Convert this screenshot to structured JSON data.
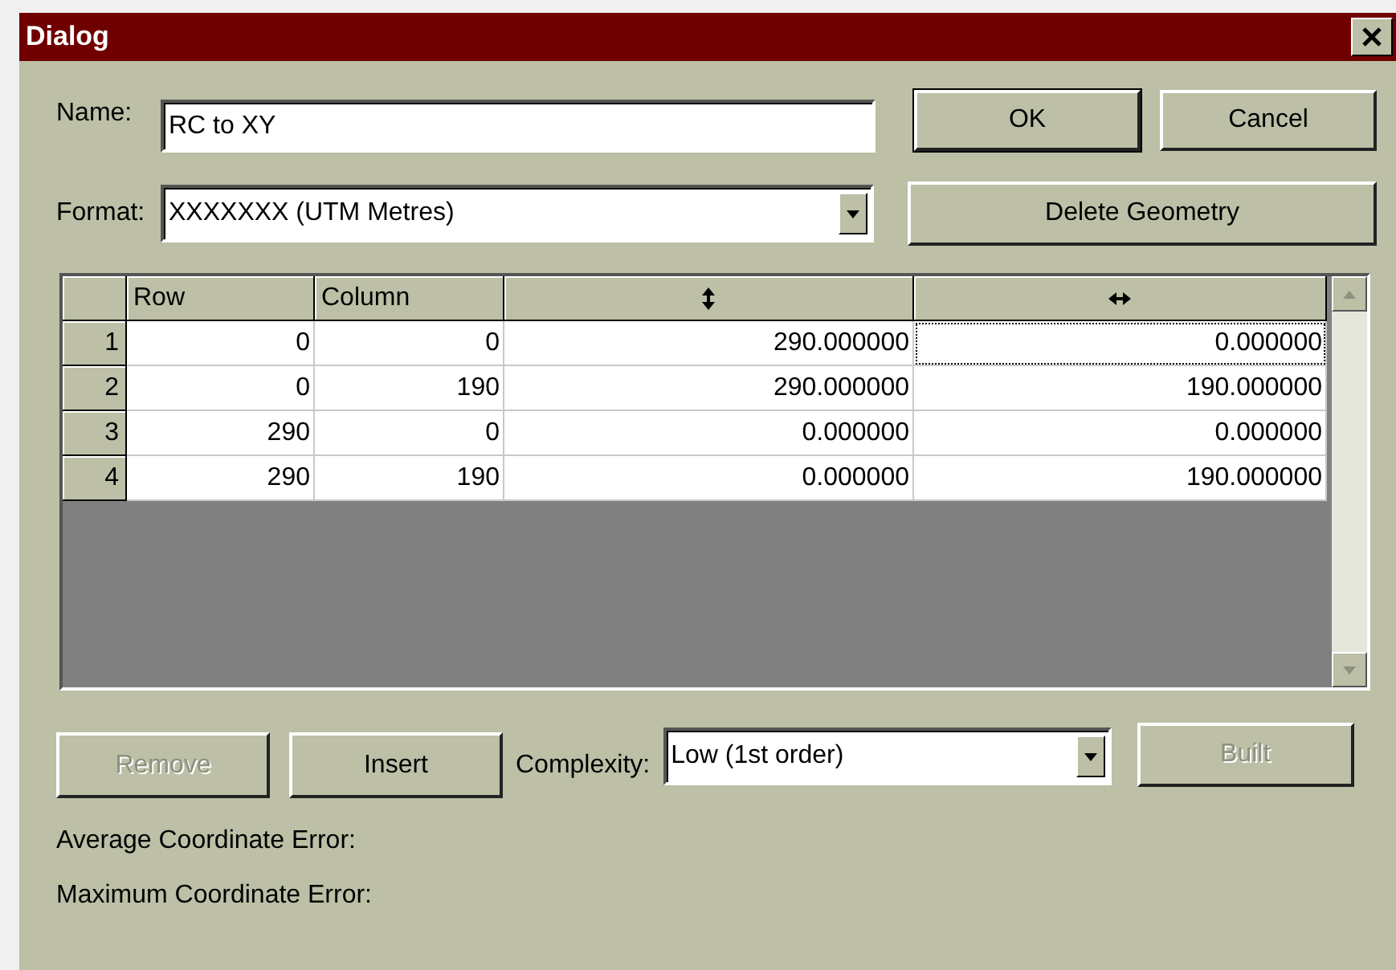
{
  "window": {
    "title": "Dialog"
  },
  "name_field": {
    "label": "Name:",
    "value": "RC to XY"
  },
  "format_field": {
    "label": "Format:",
    "value": "XXXXXXX (UTM Metres)"
  },
  "buttons_top": [
    {
      "label": "OK",
      "default": true,
      "disabled": false
    },
    {
      "label": "Cancel",
      "default": false,
      "disabled": false
    }
  ],
  "delete_button": {
    "label": "Delete Geometry",
    "disabled": false
  },
  "table": {
    "columns": [
      {
        "kind": "text",
        "label": "Row"
      },
      {
        "kind": "text",
        "label": "Column"
      },
      {
        "kind": "vertical-arrows"
      },
      {
        "kind": "horizontal-arrows"
      }
    ],
    "rows": [
      {
        "number": "1",
        "cells": [
          {
            "text": "0",
            "focused": false
          },
          {
            "text": "0",
            "focused": false
          },
          {
            "text": "290.000000",
            "focused": false
          },
          {
            "text": "0.000000",
            "focused": true
          }
        ]
      },
      {
        "number": "2",
        "cells": [
          {
            "text": "0",
            "focused": false
          },
          {
            "text": "190",
            "focused": false
          },
          {
            "text": "290.000000",
            "focused": false
          },
          {
            "text": "190.000000",
            "focused": false
          }
        ]
      },
      {
        "number": "3",
        "cells": [
          {
            "text": "290",
            "focused": false
          },
          {
            "text": "0",
            "focused": false
          },
          {
            "text": "0.000000",
            "focused": false
          },
          {
            "text": "0.000000",
            "focused": false
          }
        ]
      },
      {
        "number": "4",
        "cells": [
          {
            "text": "290",
            "focused": false
          },
          {
            "text": "190",
            "focused": false
          },
          {
            "text": "0.000000",
            "focused": false
          },
          {
            "text": "190.000000",
            "focused": false
          }
        ]
      }
    ]
  },
  "row_buttons": [
    {
      "label": "Remove",
      "disabled": true
    },
    {
      "label": "Insert",
      "disabled": false
    }
  ],
  "complexity": {
    "label": "Complexity:",
    "value": "Low (1st order)"
  },
  "build_button": {
    "label": "Built",
    "disabled": true
  },
  "stats": [
    {
      "label": "Average Coordinate Error:"
    },
    {
      "label": "Maximum Coordinate Error:"
    }
  ]
}
